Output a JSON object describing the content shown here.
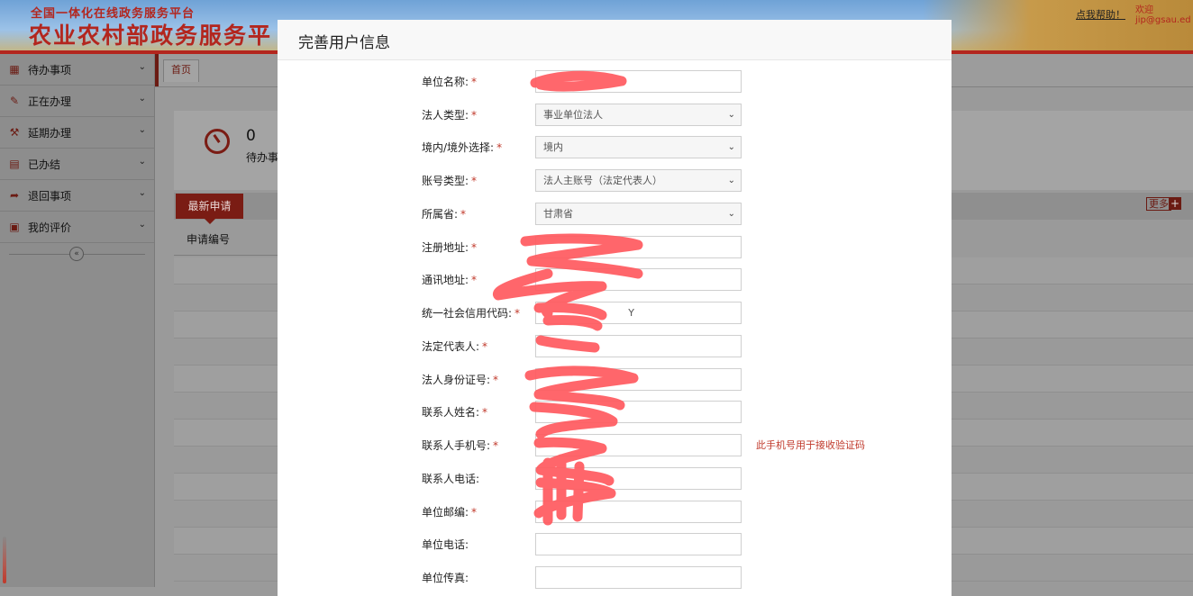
{
  "header": {
    "platform": "全国一体化在线政务服务平台",
    "site_name": "农业农村部政务服务平",
    "help_link": "点我帮助！",
    "welcome": "欢迎",
    "user": "jip@gsau.ed"
  },
  "sidebar": {
    "items": [
      {
        "label": "待办事项",
        "icon": "briefcase-icon"
      },
      {
        "label": "正在办理",
        "icon": "edit-icon"
      },
      {
        "label": "延期办理",
        "icon": "gavel-icon"
      },
      {
        "label": "已办结",
        "icon": "document-icon"
      },
      {
        "label": "退回事项",
        "icon": "return-icon"
      },
      {
        "label": "我的评价",
        "icon": "gift-icon"
      }
    ],
    "collapse_symbol": "«"
  },
  "main": {
    "home_tab": "首页",
    "stat_value": "0",
    "stat_label": "待办事",
    "latest_tab": "最新申请",
    "more_label": "更多",
    "more_plus": "+",
    "column_header": "申请编号"
  },
  "modal": {
    "title": "完善用户信息",
    "fields": [
      {
        "label": "单位名称:",
        "required": "*",
        "type": "text",
        "value": ""
      },
      {
        "label": "法人类型:",
        "required": "*",
        "type": "select",
        "value": "事业单位法人"
      },
      {
        "label": "境内/境外选择:",
        "required": "*",
        "type": "select",
        "value": "境内"
      },
      {
        "label": "账号类型:",
        "required": "*",
        "type": "select",
        "value": "法人主账号（法定代表人）"
      },
      {
        "label": "所属省:",
        "required": "*",
        "type": "select",
        "value": "甘肃省"
      },
      {
        "label": "注册地址:",
        "required": "*",
        "type": "text",
        "value": ""
      },
      {
        "label": "通讯地址:",
        "required": "*",
        "type": "text",
        "value": ""
      },
      {
        "label": "统一社会信用代码:",
        "required": "*",
        "type": "text",
        "value": "Y"
      },
      {
        "label": "法定代表人:",
        "required": "*",
        "type": "text",
        "value": ""
      },
      {
        "label": "法人身份证号:",
        "required": "*",
        "type": "text",
        "value": ""
      },
      {
        "label": "联系人姓名:",
        "required": "*",
        "type": "text",
        "value": ""
      },
      {
        "label": "联系人手机号:",
        "required": "*",
        "type": "text",
        "value": "",
        "hint": "此手机号用于接收验证码"
      },
      {
        "label": "联系人电话:",
        "required": "",
        "type": "text",
        "value": ""
      },
      {
        "label": "单位邮编:",
        "required": "*",
        "type": "text",
        "value": ""
      },
      {
        "label": "单位电话:",
        "required": "",
        "type": "text",
        "value": ""
      },
      {
        "label": "单位传真:",
        "required": "",
        "type": "text",
        "value": ""
      }
    ]
  },
  "colors": {
    "brand_red": "#b3261e",
    "dark_red": "#7a1c14",
    "required_red": "#c0392b",
    "redaction": "#ff5a5f"
  }
}
